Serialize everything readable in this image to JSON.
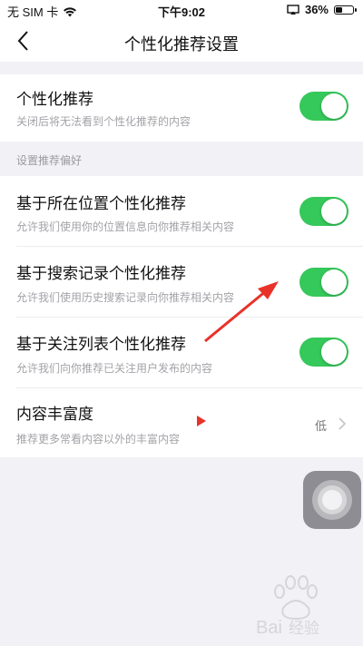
{
  "status_bar": {
    "carrier": "无 SIM 卡",
    "time": "下午9:02",
    "battery": "36%",
    "icons": [
      "wifi-icon",
      "screen-mirroring-icon",
      "battery-icon"
    ]
  },
  "nav": {
    "title": "个性化推荐设置",
    "back_icon": "chevron-left-icon"
  },
  "main_toggle": {
    "title": "个性化推荐",
    "subtitle": "关闭后将无法看到个性化推荐的内容",
    "on": true
  },
  "section": {
    "header": "设置推荐偏好",
    "rows": [
      {
        "title": "基于所在位置个性化推荐",
        "subtitle": "允许我们使用你的位置信息向你推荐相关内容",
        "on": true
      },
      {
        "title": "基于搜索记录个性化推荐",
        "subtitle": "允许我们使用历史搜索记录向你推荐相关内容",
        "on": true
      },
      {
        "title": "基于关注列表个性化推荐",
        "subtitle": "允许我们向你推荐已关注用户发布的内容",
        "on": true
      }
    ],
    "richness": {
      "title": "内容丰富度",
      "subtitle": "推荐更多常看内容以外的丰富内容",
      "value": "低"
    }
  },
  "watermark": "Baidu 经验",
  "colors": {
    "toggle_on": "#35c85a",
    "background": "#f2f2f6",
    "annotation": "#e8322a"
  }
}
